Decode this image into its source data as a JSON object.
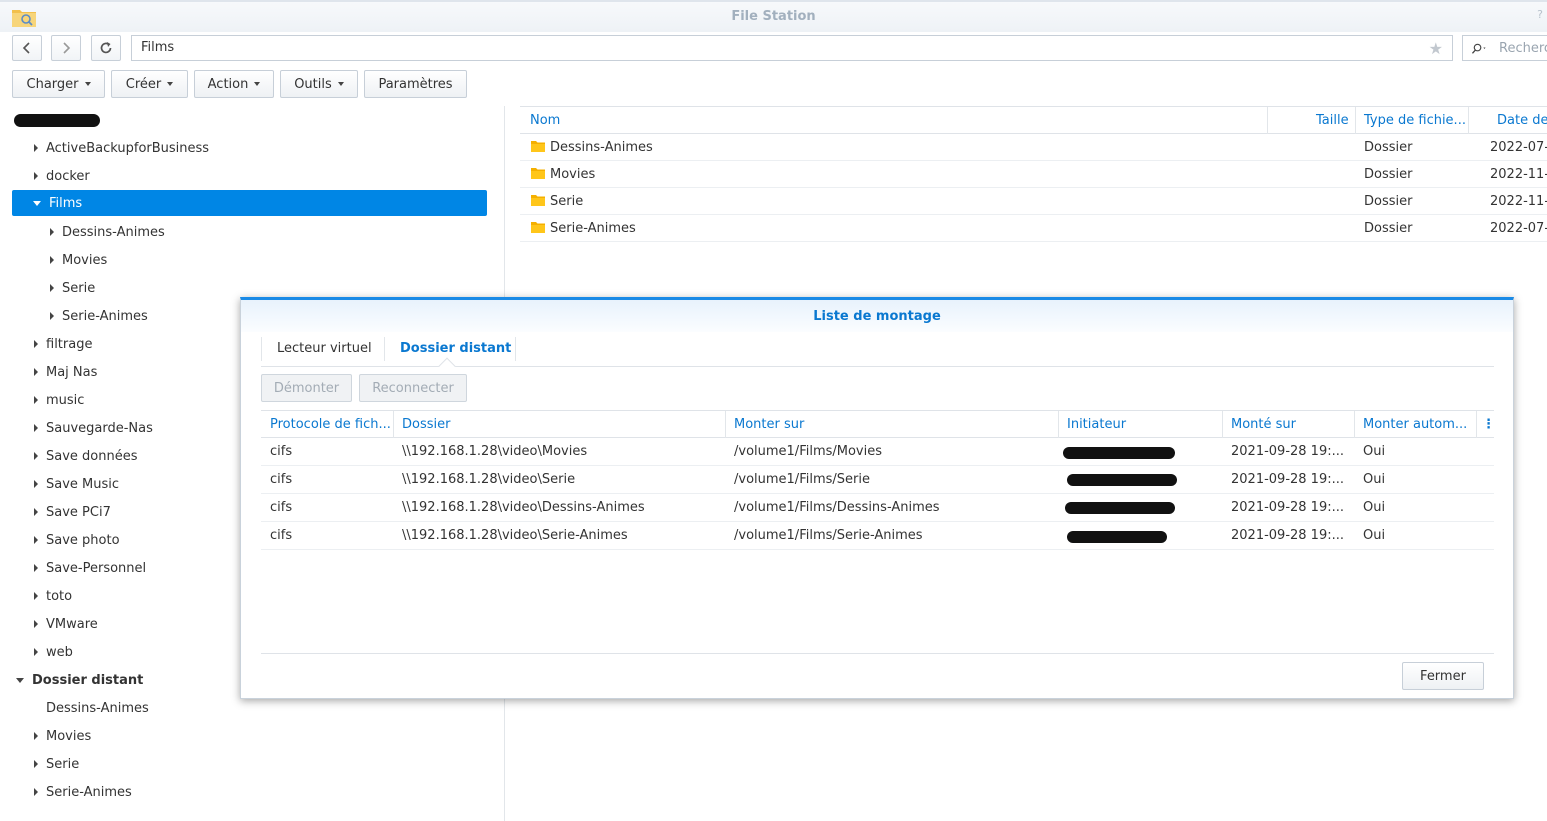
{
  "window": {
    "title": "File Station"
  },
  "nav": {
    "path": "Films",
    "search_placeholder": "Rechercher"
  },
  "toolbar": {
    "buttons": [
      "Charger",
      "Créer",
      "Action",
      "Outils",
      "Paramètres"
    ]
  },
  "tree": {
    "items": [
      "ActiveBackupforBusiness",
      "docker",
      "Films",
      "Dessins-Animes",
      "Movies",
      "Serie",
      "Serie-Animes",
      "filtrage",
      "Maj Nas",
      "music",
      "Sauvegarde-Nas",
      "Save données",
      "Save Music",
      "Save PCi7",
      "Save photo",
      "Save-Personnel",
      "toto",
      "VMware",
      "web",
      "Dossier distant",
      "Dessins-Animes",
      "Movies",
      "Serie",
      "Serie-Animes"
    ]
  },
  "filelist": {
    "columns": [
      "Nom",
      "Taille",
      "Type de fichie...",
      "Date de"
    ],
    "rows": [
      {
        "name": "Dessins-Animes",
        "type": "Dossier",
        "date": "2022-07-"
      },
      {
        "name": "Movies",
        "type": "Dossier",
        "date": "2022-11-"
      },
      {
        "name": "Serie",
        "type": "Dossier",
        "date": "2022-11-"
      },
      {
        "name": "Serie-Animes",
        "type": "Dossier",
        "date": "2022-07-"
      }
    ]
  },
  "dialog": {
    "title": "Liste de montage",
    "tabs": [
      "Lecteur virtuel",
      "Dossier distant"
    ],
    "active_tab": "Dossier distant",
    "buttons": {
      "unmount": "Démonter",
      "reconnect": "Reconnecter",
      "close": "Fermer"
    },
    "columns": [
      "Protocole de fich...",
      "Dossier",
      "Monter sur",
      "Initiateur",
      "Monté sur",
      "Monter autom...",
      "⋮"
    ],
    "rows": [
      {
        "protocol": "cifs",
        "folder": "\\\\192.168.1.28\\video\\Movies",
        "mount": "/volume1/Films/Movies",
        "mounted": "2021-09-28 19:...",
        "auto": "Oui"
      },
      {
        "protocol": "cifs",
        "folder": "\\\\192.168.1.28\\video\\Serie",
        "mount": "/volume1/Films/Serie",
        "mounted": "2021-09-28 19:...",
        "auto": "Oui"
      },
      {
        "protocol": "cifs",
        "folder": "\\\\192.168.1.28\\video\\Dessins-Animes",
        "mount": "/volume1/Films/Dessins-Animes",
        "mounted": "2021-09-28 19:...",
        "auto": "Oui"
      },
      {
        "protocol": "cifs",
        "folder": "\\\\192.168.1.28\\video\\Serie-Animes",
        "mount": "/volume1/Films/Serie-Animes",
        "mounted": "2021-09-28 19:...",
        "auto": "Oui"
      }
    ]
  },
  "colors": {
    "accent": "#0086e5",
    "link": "#0a78d0",
    "folder": "#f5b000"
  }
}
